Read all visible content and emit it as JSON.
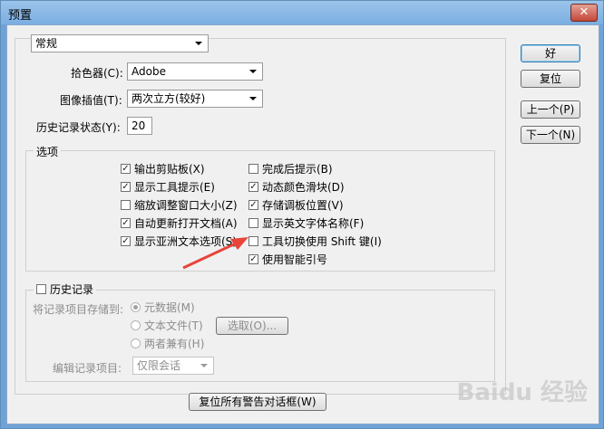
{
  "window": {
    "title": "预置",
    "close_glyph": "✕"
  },
  "general": {
    "section_select": "常规",
    "color_picker_label": "拾色器(C):",
    "color_picker_value": "Adobe",
    "interpolation_label": "图像插值(T):",
    "interpolation_value": "两次立方(较好)",
    "history_states_label": "历史记录状态(Y):",
    "history_states_value": "20"
  },
  "options": {
    "title": "选项",
    "left": [
      {
        "label": "输出剪贴板(X)",
        "checked": true
      },
      {
        "label": "显示工具提示(E)",
        "checked": true
      },
      {
        "label": "缩放调整窗口大小(Z)",
        "checked": false
      },
      {
        "label": "自动更新打开文档(A)",
        "checked": true
      },
      {
        "label": "显示亚洲文本选项(S)",
        "checked": true
      }
    ],
    "right": [
      {
        "label": "完成后提示(B)",
        "checked": false
      },
      {
        "label": "动态颜色滑块(D)",
        "checked": true
      },
      {
        "label": "存储调板位置(V)",
        "checked": true
      },
      {
        "label": "显示英文字体名称(F)",
        "checked": false
      },
      {
        "label": "工具切换使用 Shift 键(I)",
        "checked": false
      },
      {
        "label": "使用智能引号",
        "checked": true
      }
    ]
  },
  "history": {
    "title": "历史记录",
    "enabled": false,
    "save_to_label": "将记录项目存储到:",
    "radio_metadata": "元数据(M)",
    "radio_textfile": "文本文件(T)",
    "radio_both": "两者兼有(H)",
    "choose_button": "选取(O)...",
    "edit_log_label": "编辑记录项目:",
    "edit_log_value": "仅限会话"
  },
  "reset_warnings_button": "复位所有警告对话框(W)",
  "buttons": {
    "ok": "好",
    "reset": "复位",
    "prev": "上一个(P)",
    "next": "下一个(N)"
  },
  "watermark": "Baidu 经验",
  "colors": {
    "title_bar": "#7aaee2",
    "annotation_arrow": "#e8443a"
  }
}
